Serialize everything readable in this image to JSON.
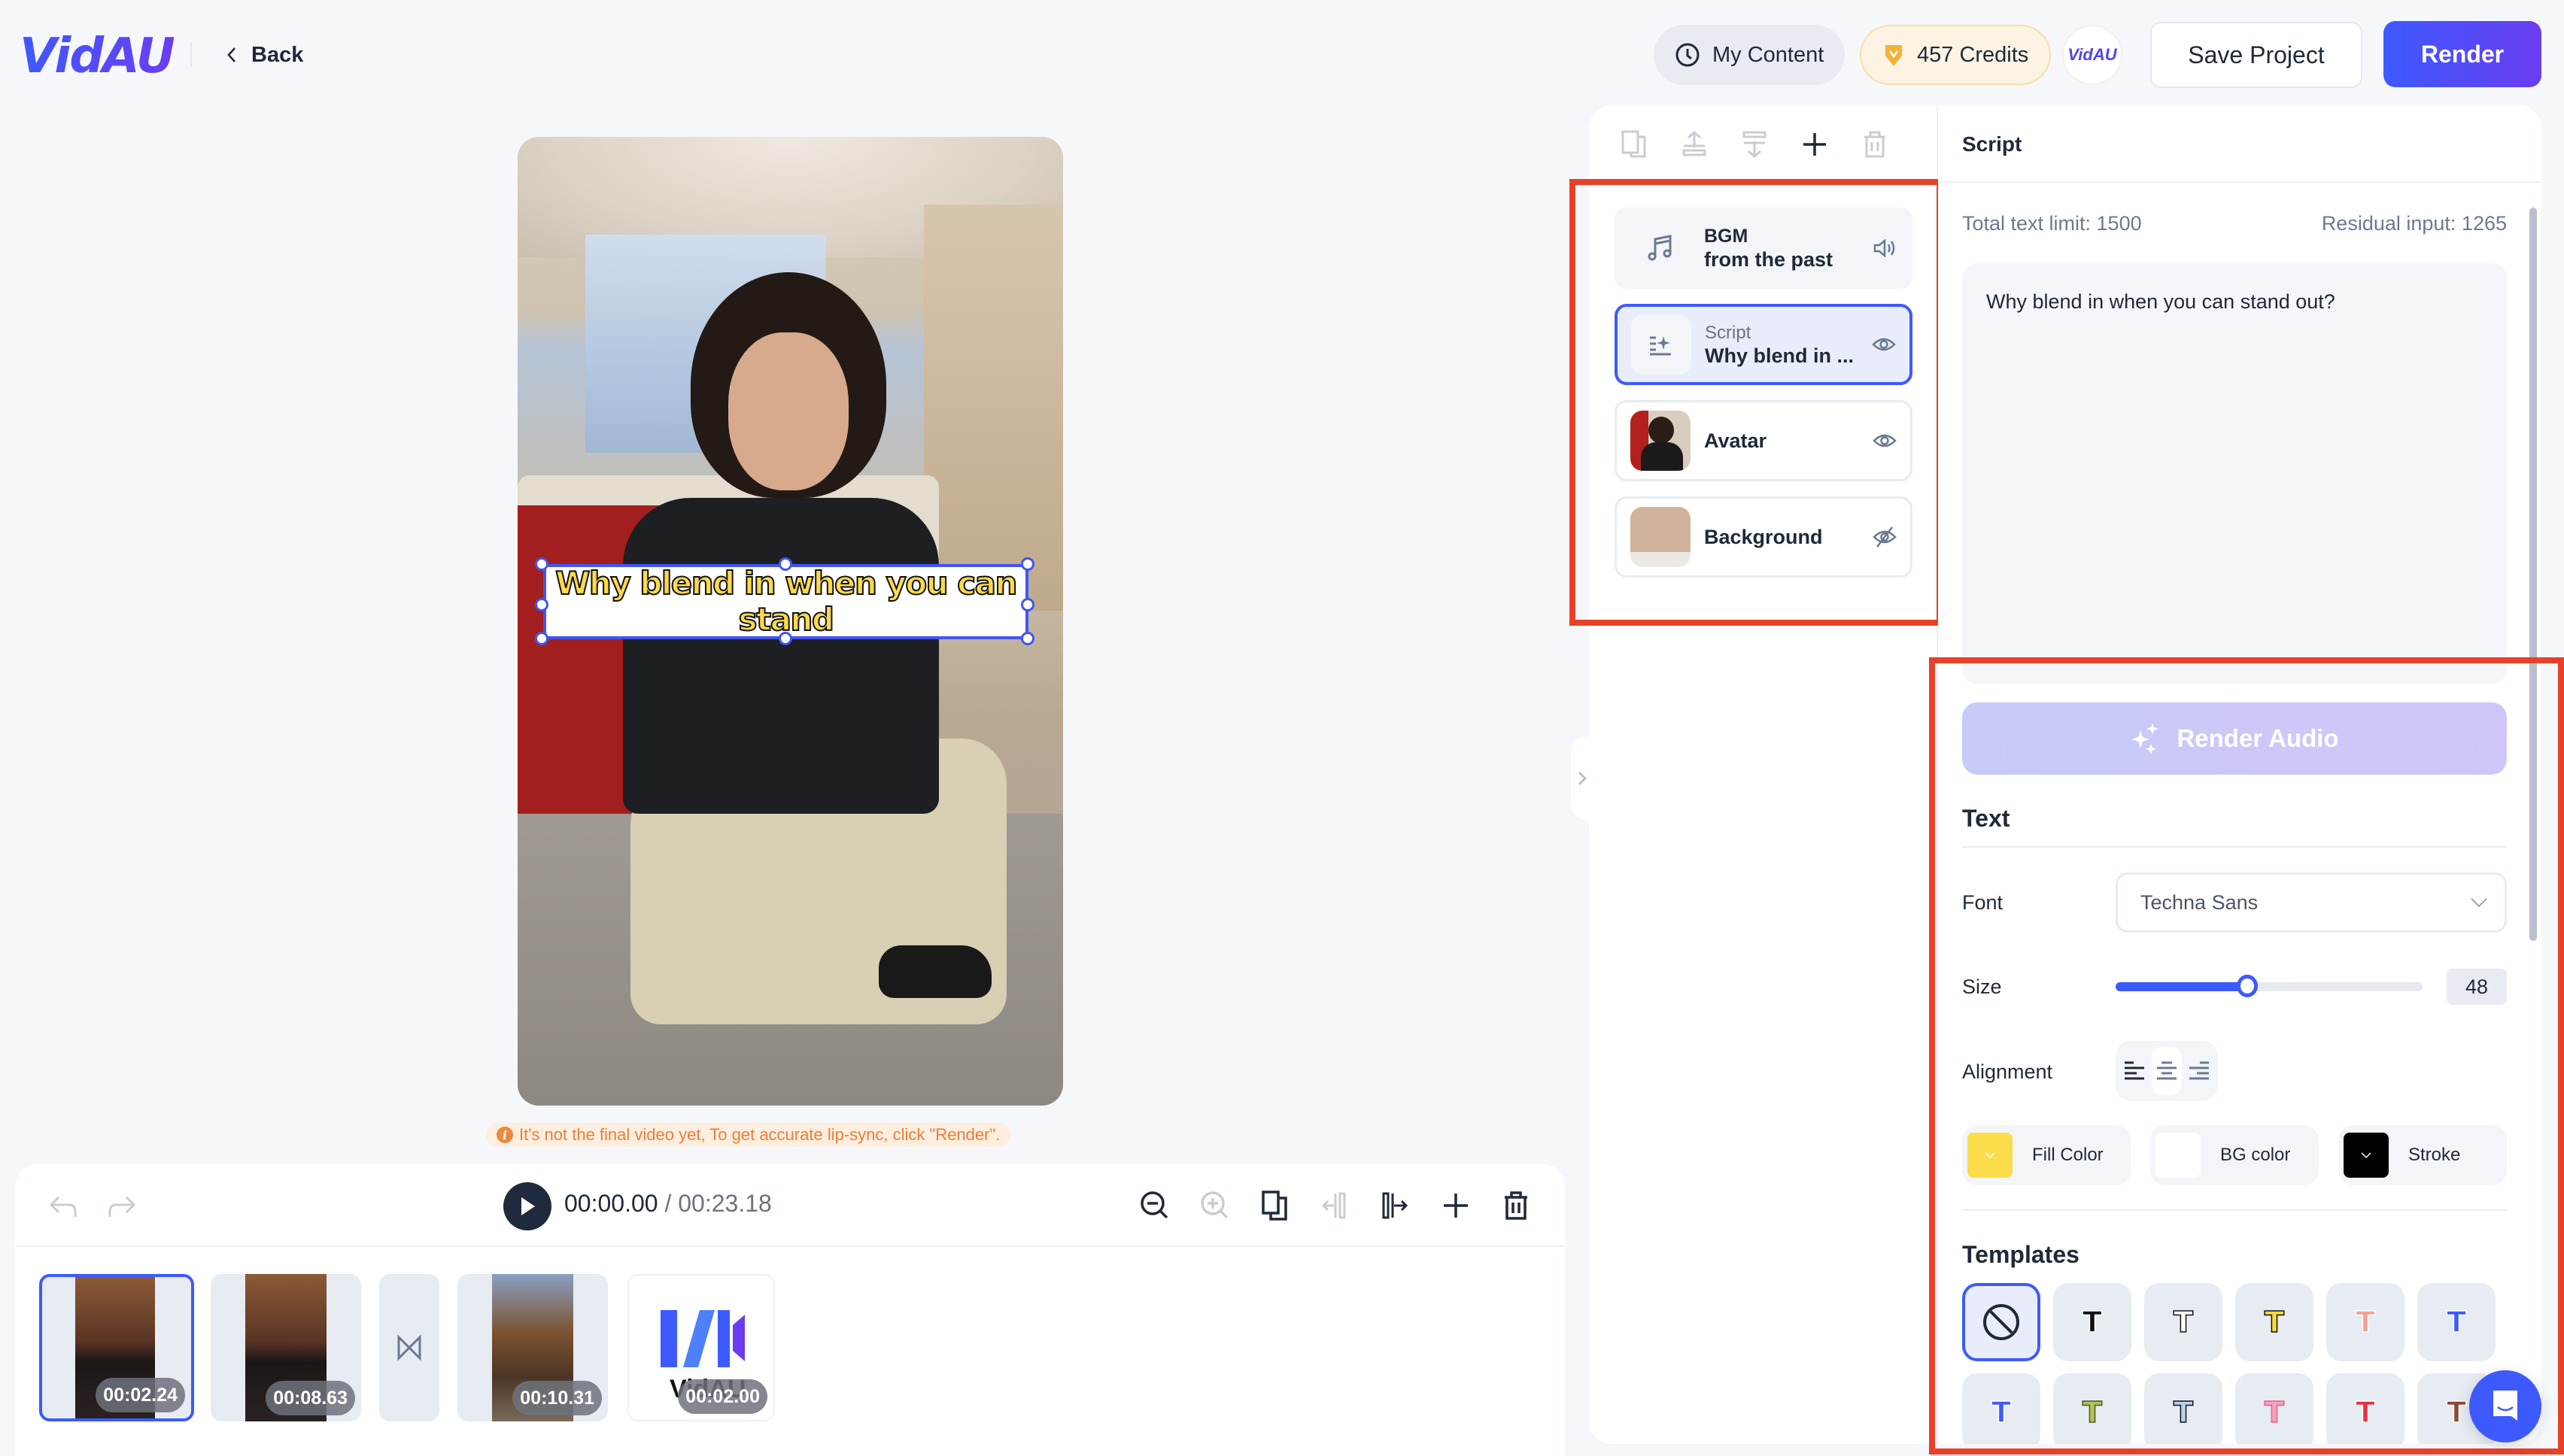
{
  "header": {
    "logo": "VidAU",
    "back_label": "Back",
    "my_content_label": "My Content",
    "credits_label": "457 Credits",
    "avatar_logo": "VidAU",
    "save_label": "Save Project",
    "render_label": "Render"
  },
  "preview": {
    "caption_line1": "Why blend in when you can",
    "caption_line2": "stand",
    "notice": "It's not the final video yet, To get accurate lip-sync, click \"Render\"."
  },
  "playback": {
    "current_time": "00:00.00",
    "separator": " / ",
    "total_time": "00:23.18"
  },
  "timeline": {
    "clips": [
      {
        "duration": "00:02.24",
        "selected": true
      },
      {
        "duration": "00:08.63",
        "selected": false
      },
      {
        "duration": "00:10.31",
        "selected": false
      },
      {
        "duration": "00:02.00",
        "selected": false,
        "label": "VidAU"
      }
    ]
  },
  "layers": {
    "items": [
      {
        "type": "BGM",
        "name": "from the past",
        "icon": "music-note-icon",
        "toggle": "volume-icon"
      },
      {
        "type": "Script",
        "name": "Why blend in ...",
        "icon": "script-sparkle-icon",
        "toggle": "eye-icon",
        "active": true
      },
      {
        "type": "",
        "name": "Avatar",
        "icon": "avatar-thumbnail",
        "toggle": "eye-icon"
      },
      {
        "type": "",
        "name": "Background",
        "icon": "background-thumbnail",
        "toggle": "eye-off-icon"
      }
    ]
  },
  "script_panel": {
    "title": "Script",
    "limit_label": "Total text limit: 1500",
    "residual_label": "Residual input: 1265",
    "text": "Why blend in when you can stand out?",
    "render_audio_label": "Render Audio",
    "text_section": "Text",
    "font_label": "Font",
    "font_value": "Techna Sans",
    "size_label": "Size",
    "size_value": "48",
    "size_fraction": 0.43,
    "alignment_label": "Alignment",
    "alignment_selected": "center",
    "fill_color_label": "Fill Color",
    "fill_color": "#f9dd4b",
    "bg_color_label": "BG color",
    "bg_color": "#ffffff",
    "stroke_label": "Stroke",
    "stroke_color": "#000000",
    "templates_label": "Templates",
    "templates": [
      {
        "name": "none",
        "color": "",
        "stroke": ""
      },
      {
        "name": "plain-black",
        "color": "#111111",
        "stroke": "#ffffff"
      },
      {
        "name": "white-black-stroke",
        "color": "#ffffff",
        "stroke": "#111111"
      },
      {
        "name": "yellow-black-stroke",
        "color": "#f9d93d",
        "stroke": "#111111"
      },
      {
        "name": "salmon-outline",
        "color": "#f4a092",
        "stroke": "#ffffff"
      },
      {
        "name": "blue-outline",
        "color": "#3d5afe",
        "stroke": "#ffffff"
      },
      {
        "name": "blue-plain",
        "color": "#3d5afe",
        "stroke": "#ffffff"
      },
      {
        "name": "olive-green",
        "color": "#b8c255",
        "stroke": "#3d5a2e"
      },
      {
        "name": "lightblue-black",
        "color": "#b7d2ee",
        "stroke": "#111111"
      },
      {
        "name": "pink-outline",
        "color": "#f7a1c0",
        "stroke": "#e0628e"
      },
      {
        "name": "red-outline",
        "color": "#e5323c",
        "stroke": "#ffffff"
      },
      {
        "name": "brown",
        "color": "#8a4a36",
        "stroke": "#ffffff"
      }
    ]
  }
}
